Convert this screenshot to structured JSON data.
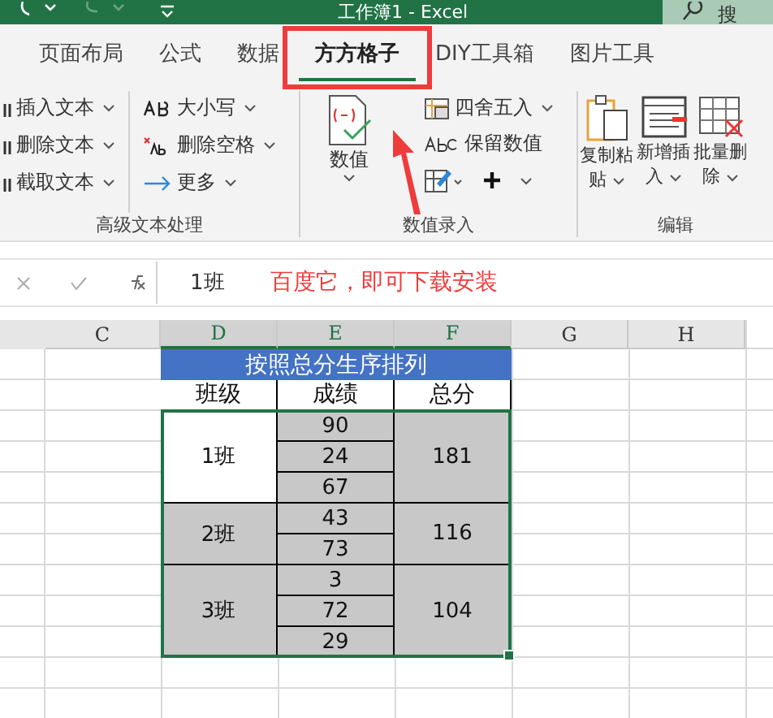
{
  "window": {
    "title": "工作簿1 - Excel",
    "search": "搜"
  },
  "tabs": [
    {
      "label": "页面布局",
      "selected": false
    },
    {
      "label": "公式",
      "selected": false
    },
    {
      "label": "数据",
      "selected": false
    },
    {
      "label": "方方格子",
      "selected": true
    },
    {
      "label": "DIY工具箱",
      "selected": false
    },
    {
      "label": "图片工具",
      "selected": false
    }
  ],
  "ribbon": [
    {
      "label": "高级文本处理",
      "kind": "text",
      "columns": [
        [
          "插入文本",
          "删除文本",
          "截取文本"
        ],
        [
          "大小写",
          "删除空格",
          "更多"
        ]
      ]
    },
    {
      "label": "数值录入",
      "kind": "number",
      "big": "数值",
      "small": [
        "四舍五入",
        "保留数值"
      ]
    },
    {
      "label": "编辑",
      "kind": "edit",
      "buttons": [
        [
          "复制粘",
          "贴"
        ],
        [
          "新增插",
          "入"
        ],
        [
          "批量删",
          "除"
        ]
      ]
    }
  ],
  "formula_bar": {
    "value": "1班",
    "annotation": "百度它，即可下载安装"
  },
  "columns": [
    {
      "label": "C",
      "selected": false
    },
    {
      "label": "D",
      "selected": true
    },
    {
      "label": "E",
      "selected": true
    },
    {
      "label": "F",
      "selected": true
    },
    {
      "label": "G",
      "selected": false
    },
    {
      "label": "H",
      "selected": false
    }
  ],
  "table": {
    "title": "按照总分生序排列",
    "headers": [
      "班级",
      "成绩",
      "总分"
    ],
    "groups": [
      {
        "class": "1班",
        "shaded": false,
        "scores": [
          "90",
          "24",
          "67"
        ],
        "total": "181"
      },
      {
        "class": "2班",
        "shaded": true,
        "scores": [
          "43",
          "73"
        ],
        "total": "116"
      },
      {
        "class": "3班",
        "shaded": true,
        "scores": [
          "3",
          "72",
          "29"
        ],
        "total": "104"
      }
    ]
  }
}
